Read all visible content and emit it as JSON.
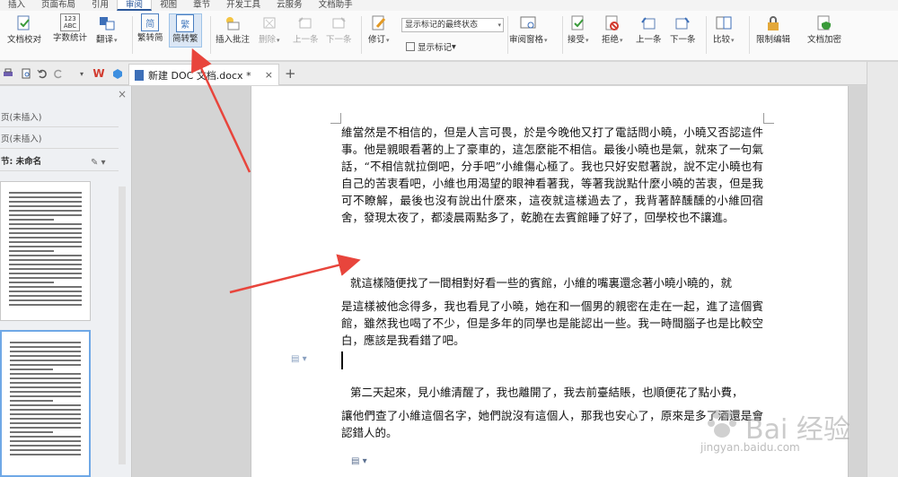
{
  "menu": {
    "tabs": [
      "插入",
      "页面布局",
      "引用",
      "审阅",
      "视图",
      "章节",
      "开发工具",
      "云服务",
      "文档助手"
    ],
    "active_index": 3
  },
  "ribbon": {
    "doc_check": "文档校对",
    "word_count": "字数统计",
    "translate": "翻译",
    "trad_to_simp": "繁转简",
    "simp_to_trad": "简转繁",
    "insert_comment": "插入批注",
    "delete": "删除",
    "prev": "上一条",
    "next": "下一条",
    "revise": "修订",
    "status_select": "显示标记的最终状态",
    "show_markup": "显示标记",
    "review_pane": "审阅窗格",
    "accept": "接受",
    "reject": "拒绝",
    "prev2": "上一条",
    "next2": "下一条",
    "compare": "比较",
    "restrict_edit": "限制编辑",
    "doc_encrypt": "文档加密",
    "icon_abc_top": "123",
    "icon_abc_bottom": "ABC",
    "icon_trad": "简",
    "icon_simp": "繁"
  },
  "tabstrip": {
    "doc_title": "新建 DOC 文档.docx *",
    "wps_logo": "W"
  },
  "leftpanel": {
    "rows": [
      "页(未插入)",
      "页(未插入)",
      "节: 未命名"
    ]
  },
  "document": {
    "paragraphs": [
      "維當然是不相信的，但是人言可畏，於是今晚他又打了電話問小曉，小曉又否認這件事。他是親眼看著的上了豪車的，這怎麼能不相信。最後小曉也是氣，就來了一句氣話，“不相信就拉倒吧，分手吧”小維傷心極了。我也只好安慰著說，說不定小曉也有自己的苦衷看吧，小維也用渴望的眼神看著我，等著我說點什麼小曉的苦衷，但是我可不瞭解，最後也沒有說出什麼來，這夜就這樣過去了，我背著醉醺醺的小維回宿舍，發現太夜了，都淩晨兩點多了，乾脆在去賓館睡了好了，回學校也不讓進。",
      "就這樣隨便找了一間相對好看一些的賓館，小維的嘴裏還念著小曉小曉的，就",
      "是這樣被他念得多，我也看見了小曉，她在和一個男的親密在走在一起，進了這個賓館，雖然我也喝了不少，但是多年的同學也是能認出一些。我一時間腦子也是比較空白，應該是我看錯了吧。",
      "第二天起來，見小維清醒了，我也離開了，我去前臺結賬，也順便花了點小費，",
      "讓他們查了小維這個名字，她們說沒有這個人，那我也安心了，原來是多了酒還是會認錯人的。"
    ]
  },
  "watermark": {
    "text": "Bai 经验",
    "url": "jingyan.baidu.com"
  },
  "colors": {
    "accent": "#2b579a",
    "arrow": "#e8453c",
    "highlight": "#dbe7f5"
  }
}
